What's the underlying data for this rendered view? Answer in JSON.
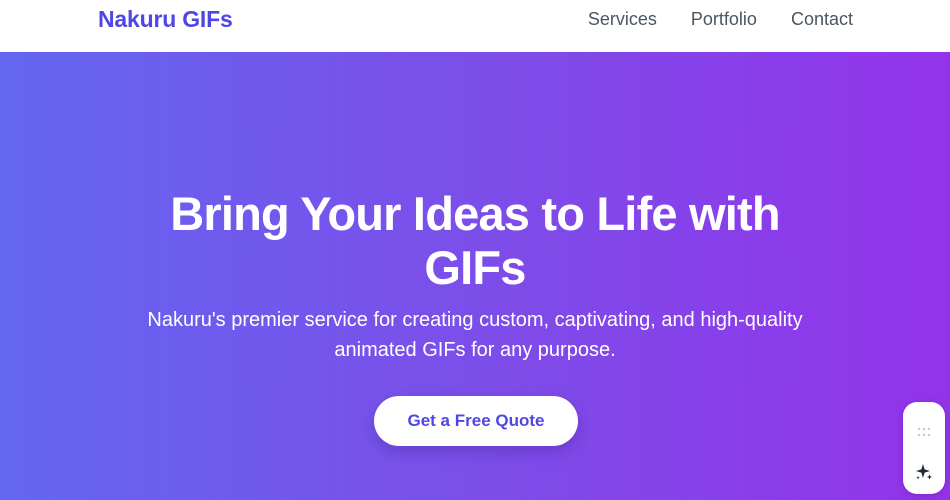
{
  "header": {
    "logo": "Nakuru GIFs",
    "nav": [
      "Services",
      "Portfolio",
      "Contact"
    ]
  },
  "hero": {
    "title_line1": "Bring Your Ideas to Life with",
    "title_line2": "GIFs",
    "subtitle_line1": "Nakuru's premier service for creating custom, captivating, and high-quality",
    "subtitle_line2": "animated GIFs for any purpose.",
    "cta_label": "Get a Free Quote"
  },
  "widget": {
    "icons": [
      "drag-handle-icon",
      "sparkle-icon"
    ]
  },
  "colors": {
    "brand": "#4f46e5",
    "gradient_start": "#6366f1",
    "gradient_end": "#9333ea",
    "nav_text": "#4b5563"
  }
}
